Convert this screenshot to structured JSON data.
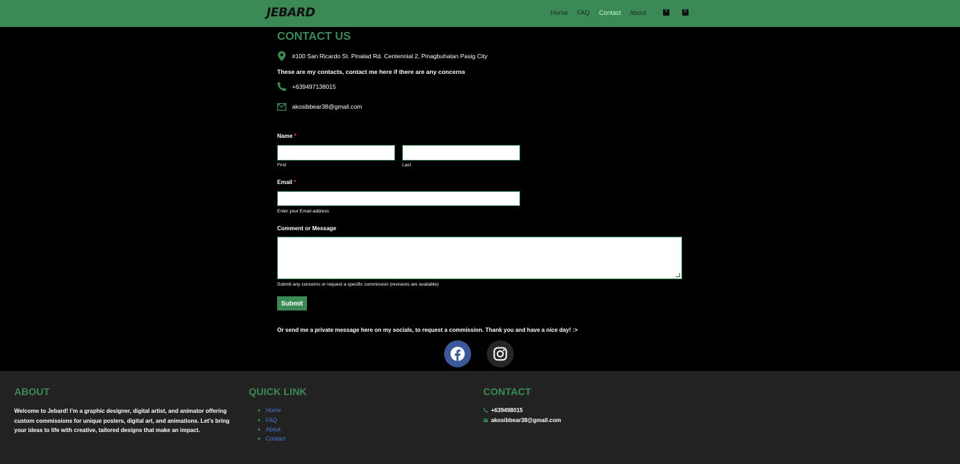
{
  "header": {
    "logo": "JEBARD",
    "nav": [
      "Home",
      "FAQ",
      "Contact",
      "About"
    ],
    "active": "Contact",
    "socials": [
      "facebook-square-icon",
      "x-square-icon"
    ]
  },
  "contact": {
    "title": "CONTACT US",
    "address": "#100 San Ricardo St. Pinalad Rd. Centennial 2, Pinagbuhatan Pasig City",
    "note": "These are my contacts, contact me here if there are any concerns",
    "phone": "+639497138015",
    "email": "akosibbear38@gmail.com"
  },
  "form": {
    "name_label": "Name",
    "required_mark": "*",
    "first_label": "First",
    "last_label": "Last",
    "first_value": "",
    "last_value": "",
    "email_label": "Email",
    "email_value": "",
    "email_help": "Enter your Email address",
    "message_label": "Comment or Message",
    "message_value": "",
    "message_help": "Submit any concerns or request a specific commission (revisions are available)",
    "submit_label": "Submit"
  },
  "private_message": "Or send me a private message here on my socials, to request a commission. Thank you and have a nice day! :>",
  "social_buttons": [
    {
      "icon": "facebook-icon",
      "color": "#3b5998"
    },
    {
      "icon": "instagram-icon",
      "color": "#262626"
    }
  ],
  "footer": {
    "about_title": "ABOUT",
    "about_text": "Welcome to Jebard! I’m a graphic designer, digital artist, and animator offering custom commissions for unique posters, digital art, and animations. Let’s bring your ideas to life with creative, tailored designs that make an impact.",
    "quick_title": "QUICK LINK",
    "quick_links": [
      "Home",
      "FAQ",
      "About",
      "Contact"
    ],
    "contact_title": "CONTACT",
    "phone": "+639498015",
    "email": "akosibbear38@gmail.com"
  },
  "colors": {
    "brand_green": "#3b8a56",
    "background": "#000000",
    "footer_bg": "#222222",
    "link_blue": "#4a7bd8"
  }
}
